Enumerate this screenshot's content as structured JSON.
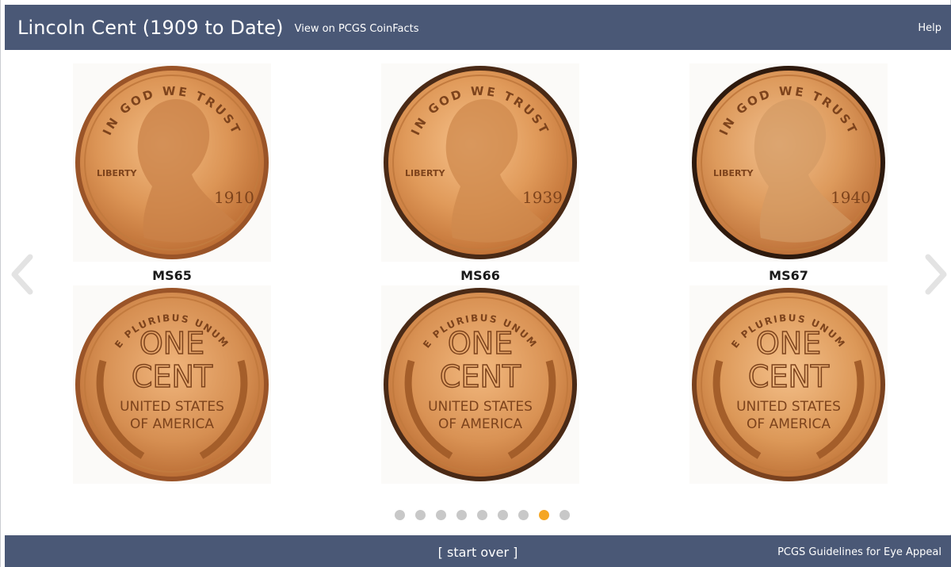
{
  "header": {
    "title": "Lincoln Cent (1909 to Date)",
    "coinfacts_link": "View on PCGS CoinFacts",
    "help_link": "Help"
  },
  "coins": [
    {
      "grade": "MS65",
      "date": "1910",
      "obverse_legend": "IN GOD WE TRUST",
      "liberty": "LIBERTY",
      "reverse_top": "E PLURIBUS UNUM",
      "reverse_line1": "ONE",
      "reverse_line2": "CENT",
      "reverse_line3": "UNITED STATES",
      "reverse_line4": "OF AMERICA"
    },
    {
      "grade": "MS66",
      "date": "1939",
      "obverse_legend": "IN GOD WE TRUST",
      "liberty": "LIBERTY",
      "reverse_top": "E PLURIBUS UNUM",
      "reverse_line1": "ONE",
      "reverse_line2": "CENT",
      "reverse_line3": "UNITED STATES",
      "reverse_line4": "OF AMERICA"
    },
    {
      "grade": "MS67",
      "date": "1940",
      "obverse_legend": "IN GOD WE TRUST",
      "liberty": "LIBERTY",
      "reverse_top": "E PLURIBUS UNUM",
      "reverse_line1": "ONE",
      "reverse_line2": "CENT",
      "reverse_line3": "UNITED STATES",
      "reverse_line4": "OF AMERICA"
    }
  ],
  "navigation": {
    "prev_icon": "chevron-left-icon",
    "next_icon": "chevron-right-icon"
  },
  "pagination": {
    "total": 9,
    "active_index": 7
  },
  "footer": {
    "start_over": "[ start over ]",
    "guidelines_link": "PCGS Guidelines for Eye Appeal"
  },
  "colors": {
    "bar": "#4a5876",
    "dot": "#c8c8c8",
    "dot_active": "#f5a623",
    "copper_light": "#e9a56a",
    "copper_mid": "#d0834a",
    "copper_dark": "#8a4a22"
  }
}
